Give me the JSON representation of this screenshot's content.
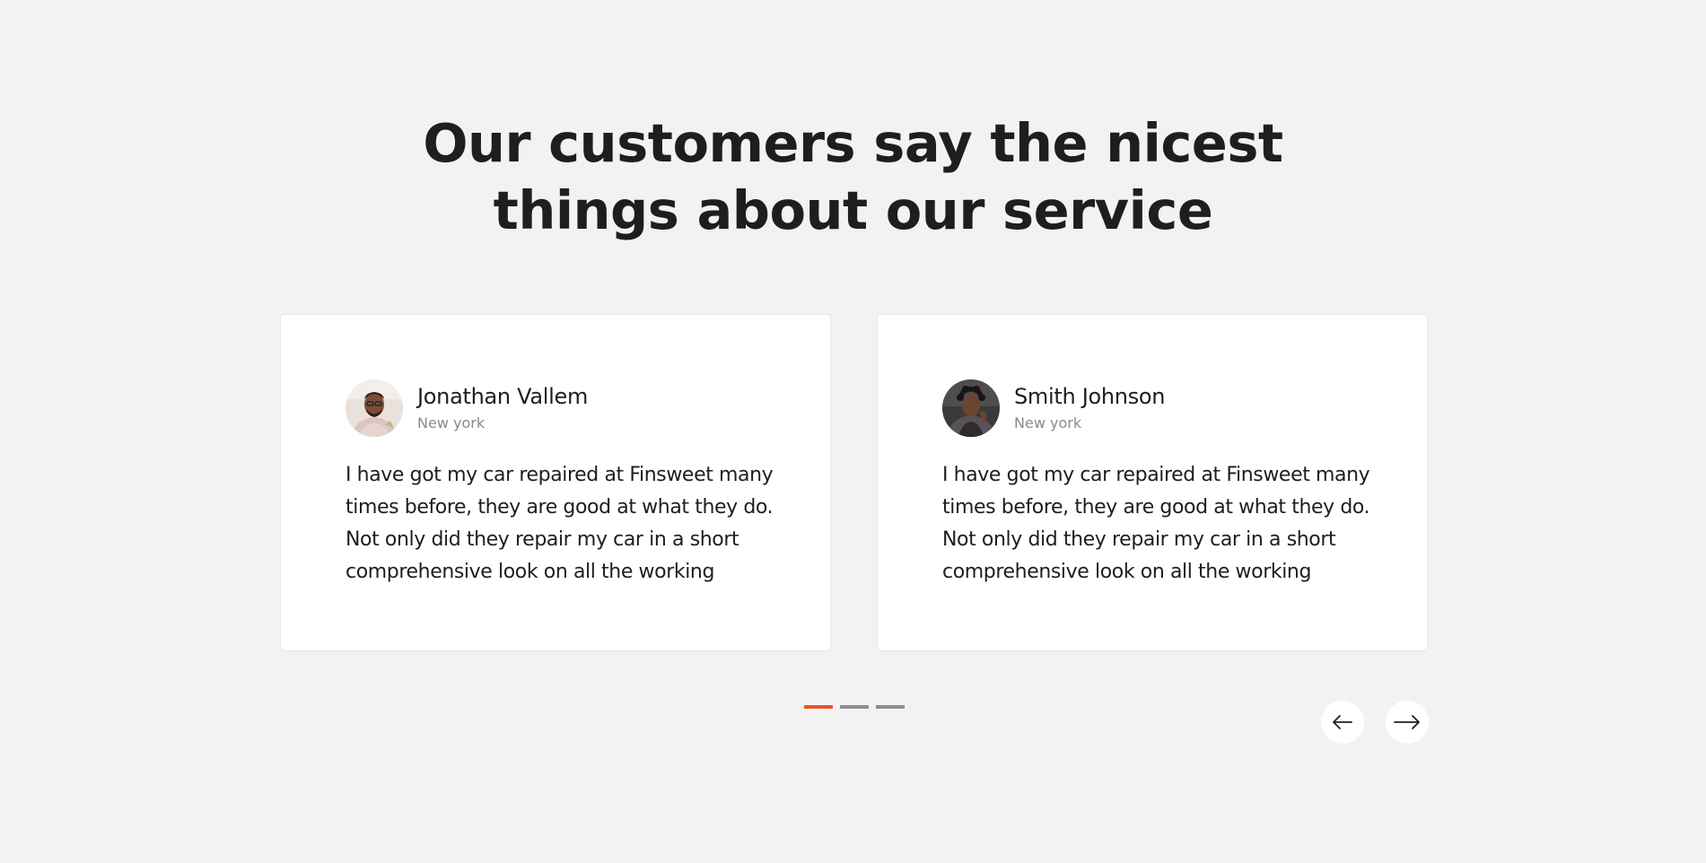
{
  "section": {
    "heading_line1": "Our customers say the nicest",
    "heading_line2": "things about our service"
  },
  "testimonials": [
    {
      "name": "Jonathan Vallem",
      "location": "New york",
      "quote": "I have got my car repaired at Finsweet many times before, they are good at what they do. Not only did they repair my car in a short comprehensive look on all the working"
    },
    {
      "name": "Smith Johnson",
      "location": "New york",
      "quote": "I have got my car repaired at Finsweet many times before, they are good at what they do. Not only did they repair my car in a short comprehensive look on all the working"
    }
  ],
  "pagination": {
    "total": 3,
    "active_index": 0
  },
  "navigation": {
    "prev_icon": "arrow-left-icon",
    "next_icon": "arrow-right-icon"
  },
  "colors": {
    "background": "#f2f2f2",
    "card": "#ffffff",
    "text": "#1e1e1e",
    "muted": "#8a8a8a",
    "accent": "#e8572a",
    "inactive_dot": "#8f8f8f"
  }
}
